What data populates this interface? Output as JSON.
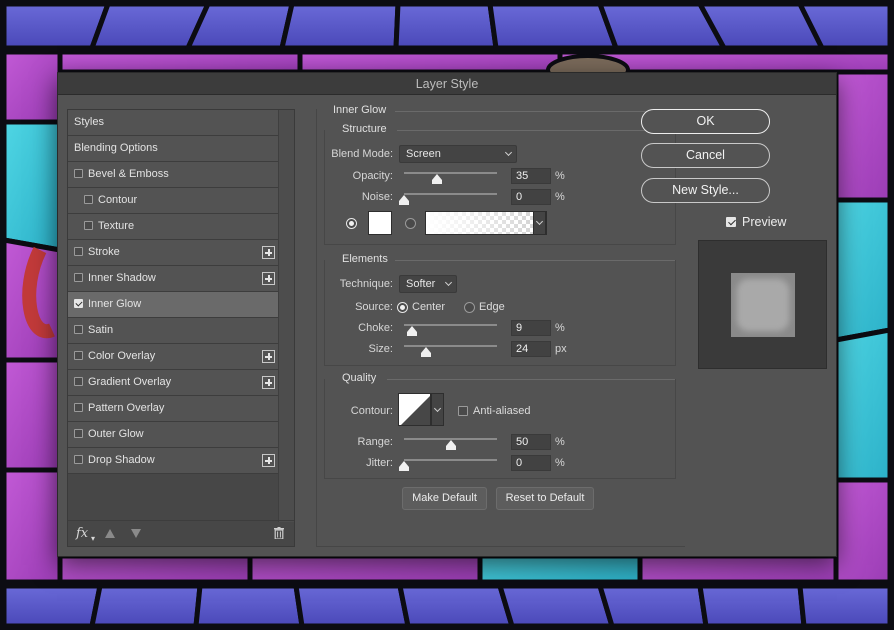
{
  "dialog": {
    "title": "Layer Style"
  },
  "styles_list": {
    "items": [
      {
        "label": "Styles",
        "checkbox": false,
        "checked": false,
        "plus": false,
        "indent": false,
        "selected": false
      },
      {
        "label": "Blending Options",
        "checkbox": false,
        "checked": false,
        "plus": false,
        "indent": false,
        "selected": false
      },
      {
        "label": "Bevel & Emboss",
        "checkbox": true,
        "checked": false,
        "plus": false,
        "indent": false,
        "selected": false
      },
      {
        "label": "Contour",
        "checkbox": true,
        "checked": false,
        "plus": false,
        "indent": true,
        "selected": false
      },
      {
        "label": "Texture",
        "checkbox": true,
        "checked": false,
        "plus": false,
        "indent": true,
        "selected": false
      },
      {
        "label": "Stroke",
        "checkbox": true,
        "checked": false,
        "plus": true,
        "indent": false,
        "selected": false
      },
      {
        "label": "Inner Shadow",
        "checkbox": true,
        "checked": false,
        "plus": true,
        "indent": false,
        "selected": false
      },
      {
        "label": "Inner Glow",
        "checkbox": true,
        "checked": true,
        "plus": false,
        "indent": false,
        "selected": true
      },
      {
        "label": "Satin",
        "checkbox": true,
        "checked": false,
        "plus": false,
        "indent": false,
        "selected": false
      },
      {
        "label": "Color Overlay",
        "checkbox": true,
        "checked": false,
        "plus": true,
        "indent": false,
        "selected": false
      },
      {
        "label": "Gradient Overlay",
        "checkbox": true,
        "checked": false,
        "plus": true,
        "indent": false,
        "selected": false
      },
      {
        "label": "Pattern Overlay",
        "checkbox": true,
        "checked": false,
        "plus": false,
        "indent": false,
        "selected": false
      },
      {
        "label": "Outer Glow",
        "checkbox": true,
        "checked": false,
        "plus": false,
        "indent": false,
        "selected": false
      },
      {
        "label": "Drop Shadow",
        "checkbox": true,
        "checked": false,
        "plus": true,
        "indent": false,
        "selected": false
      }
    ],
    "footer": {
      "fx_label": "fx",
      "fx_icon": "fx-icon",
      "move_up_icon": "arrow-up-icon",
      "move_down_icon": "arrow-down-icon",
      "delete_icon": "trash-icon"
    }
  },
  "inner_glow": {
    "section_title": "Inner Glow",
    "structure": {
      "title": "Structure",
      "blend_mode_label": "Blend Mode:",
      "blend_mode_value": "Screen",
      "opacity_label": "Opacity:",
      "opacity_value": "35",
      "opacity_unit": "%",
      "noise_label": "Noise:",
      "noise_value": "0",
      "noise_unit": "%",
      "color_mode": "solid",
      "color_hex": "#ffffff"
    },
    "elements": {
      "title": "Elements",
      "technique_label": "Technique:",
      "technique_value": "Softer",
      "source_label": "Source:",
      "source_center_label": "Center",
      "source_edge_label": "Edge",
      "source_selected": "Center",
      "choke_label": "Choke:",
      "choke_value": "9",
      "choke_unit": "%",
      "size_label": "Size:",
      "size_value": "24",
      "size_unit": "px"
    },
    "quality": {
      "title": "Quality",
      "contour_label": "Contour:",
      "anti_aliased_label": "Anti-aliased",
      "anti_aliased_checked": false,
      "range_label": "Range:",
      "range_value": "50",
      "range_unit": "%",
      "jitter_label": "Jitter:",
      "jitter_value": "0",
      "jitter_unit": "%"
    },
    "make_default_label": "Make Default",
    "reset_default_label": "Reset to Default"
  },
  "sliders": {
    "opacity": 0.35,
    "noise": 0,
    "choke": 0.09,
    "size": 0.24,
    "range": 0.5,
    "jitter": 0
  },
  "actions": {
    "ok_label": "OK",
    "cancel_label": "Cancel",
    "new_style_label": "New Style...",
    "preview_label": "Preview",
    "preview_checked": true
  },
  "colors": {
    "dialog_bg": "#535353",
    "selected_row": "#6a6a6a",
    "glass_purple": "#b04cc4",
    "glass_blue": "#5a5ac8",
    "glass_cyan": "#3cc8d8",
    "leading": "#0c0c12"
  }
}
